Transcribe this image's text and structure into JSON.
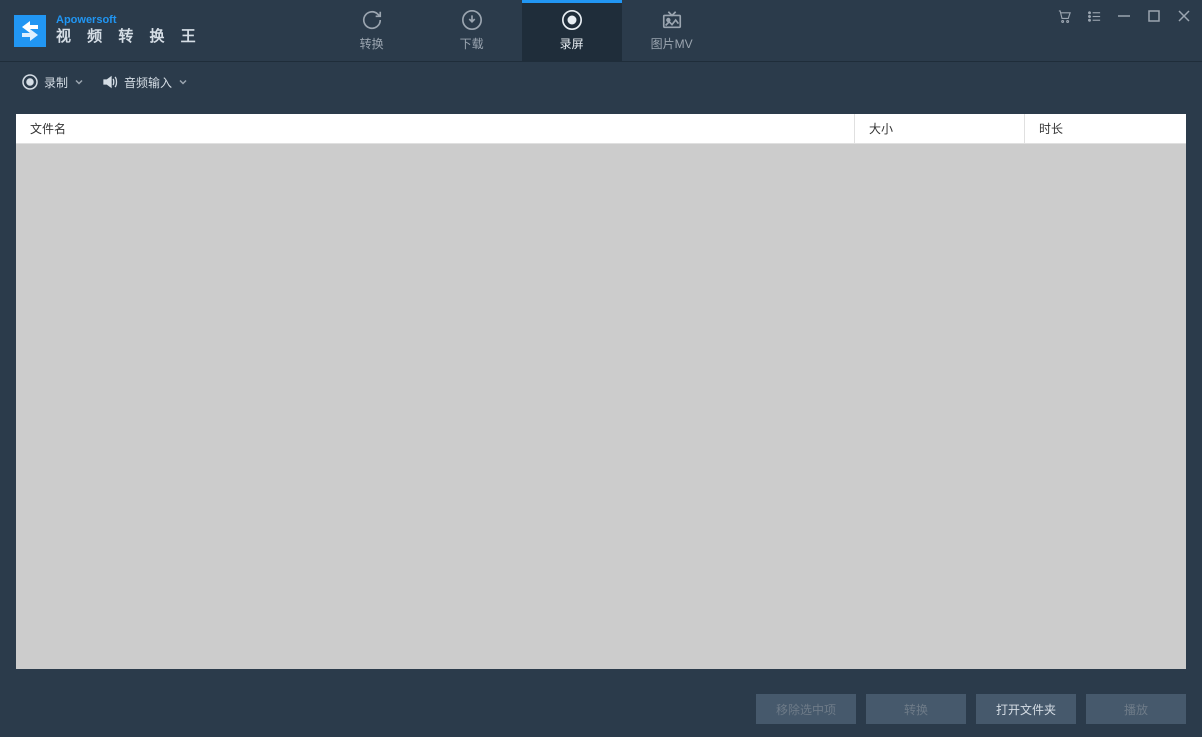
{
  "brand": "Apowersoft",
  "app_title": "视 频 转 换 王",
  "tabs": [
    {
      "label": "转换",
      "icon": "refresh"
    },
    {
      "label": "下载",
      "icon": "download"
    },
    {
      "label": "录屏",
      "icon": "record",
      "active": true
    },
    {
      "label": "图片MV",
      "icon": "image-tv"
    }
  ],
  "toolbar": {
    "record": {
      "label": "录制",
      "icon": "record-dot"
    },
    "audio": {
      "label": "音频输入",
      "icon": "speaker"
    }
  },
  "table": {
    "columns": {
      "filename": "文件名",
      "size": "大小",
      "duration": "时长"
    },
    "rows": []
  },
  "footer": {
    "remove_selected": "移除选中项",
    "convert": "转换",
    "open_folder": "打开文件夹",
    "play": "播放"
  }
}
